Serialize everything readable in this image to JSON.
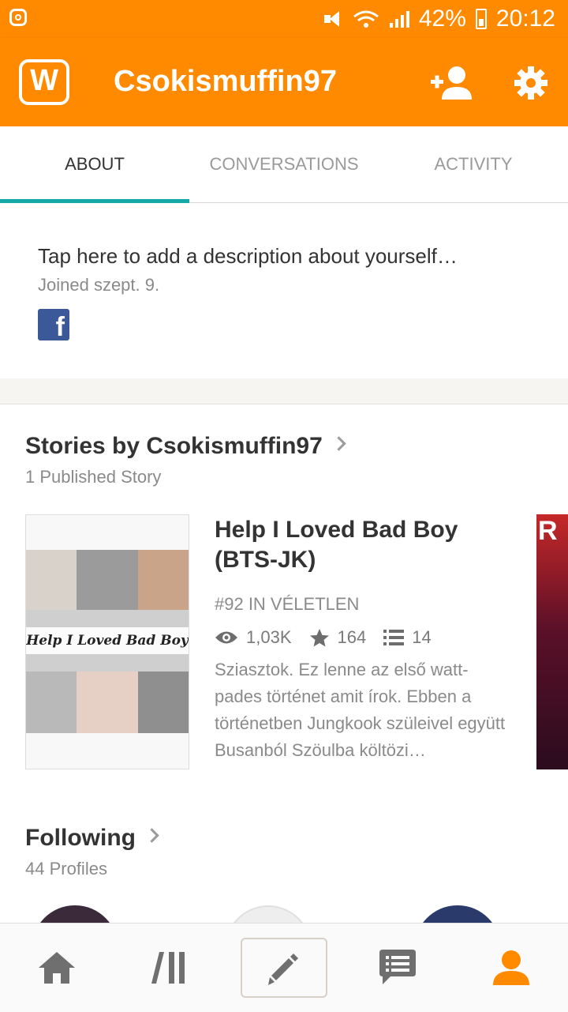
{
  "status_bar": {
    "battery": "42%",
    "time": "20:12"
  },
  "app_bar": {
    "title": "Csokismuffin97"
  },
  "tabs": [
    {
      "label": "ABOUT",
      "active": true
    },
    {
      "label": "CONVERSATIONS",
      "active": false
    },
    {
      "label": "ACTIVITY",
      "active": false
    }
  ],
  "about": {
    "description_prompt": "Tap here to add a description about yourself…",
    "joined": "Joined szept. 9."
  },
  "stories_section": {
    "title": "Stories by Csokismuffin97",
    "subtitle": "1 Published Story",
    "story": {
      "title": "Help I Loved Bad Boy (BTS-JK)",
      "cover_text": "Help I Loved Bad Boy",
      "rank": "#92 IN VÉLETLEN",
      "reads": "1,03K",
      "votes": "164",
      "parts": "14",
      "description": "Sziasztok. Ez lenne az első watt-pades történet amit írok. Ebben a történetben Jungkook szüleivel együtt Busanból Szöulba költözi…"
    },
    "next_cover_text": "R"
  },
  "following_section": {
    "title": "Following",
    "subtitle": "44 Profiles"
  },
  "colors": {
    "brand": "#ff8a00",
    "tab_indicator": "#14a8a8",
    "active_nav": "#ff8a00"
  }
}
